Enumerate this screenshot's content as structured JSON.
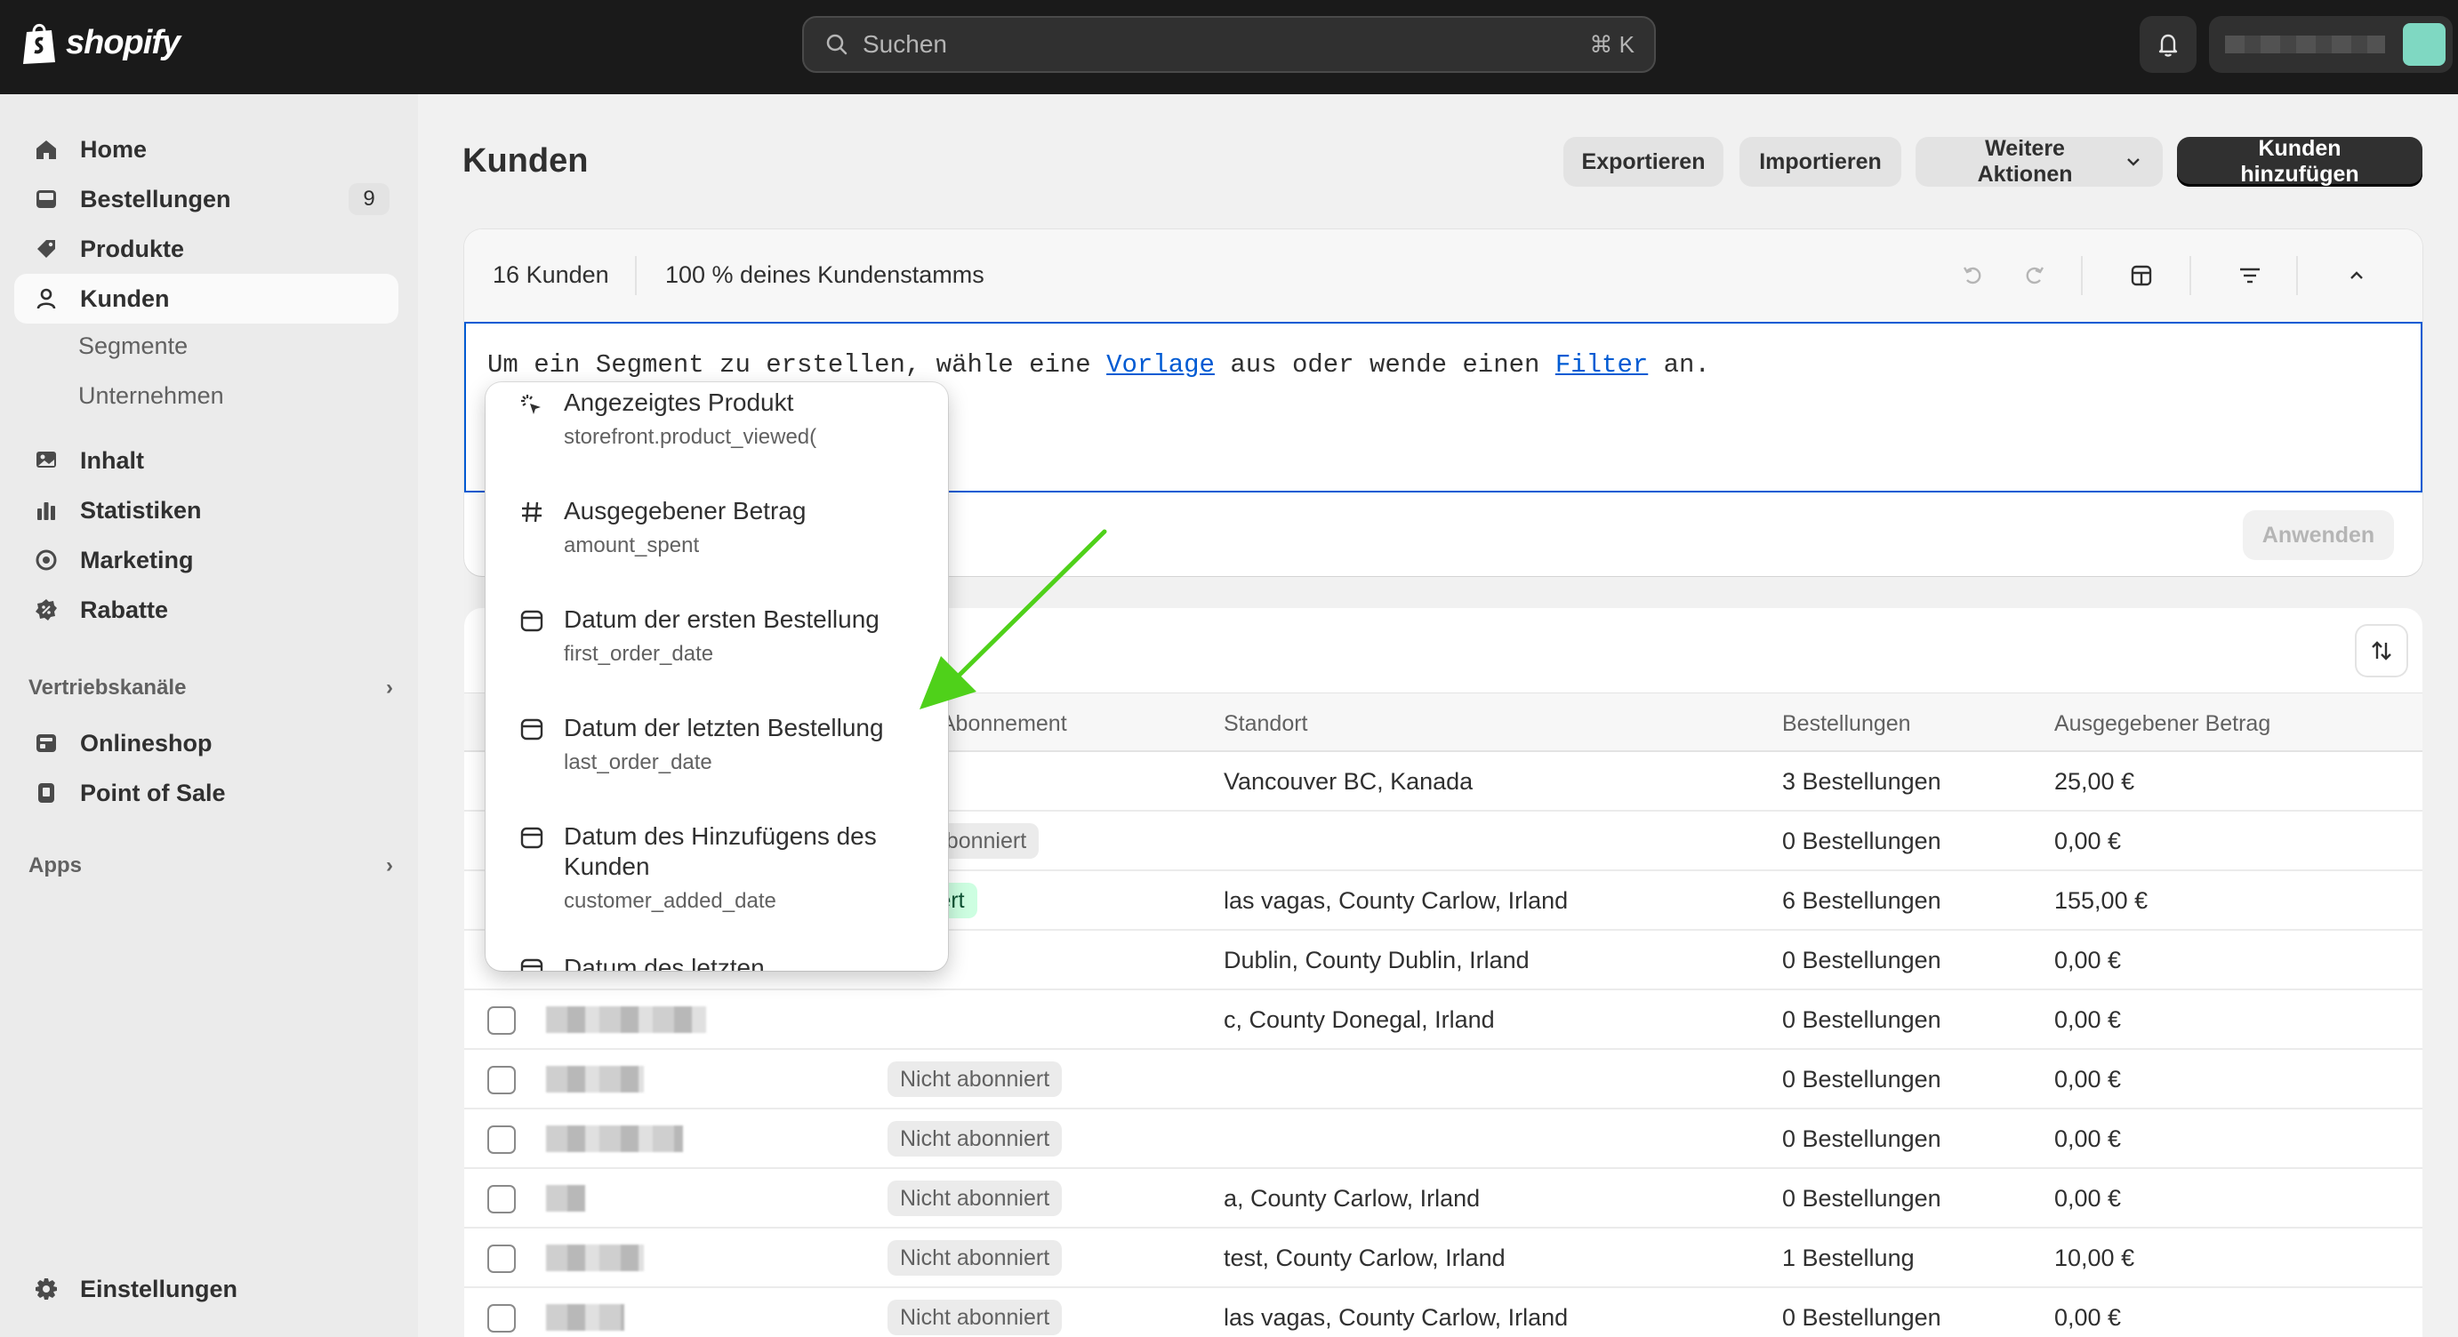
{
  "topbar": {
    "logo_text": "shopify",
    "search_placeholder": "Suchen",
    "search_shortcut": "⌘ K"
  },
  "sidebar": {
    "items": [
      {
        "label": "Home",
        "icon": "home-icon"
      },
      {
        "label": "Bestellungen",
        "icon": "inbox-icon",
        "badge": "9"
      },
      {
        "label": "Produkte",
        "icon": "tag-icon"
      },
      {
        "label": "Kunden",
        "icon": "person-icon",
        "active": true
      }
    ],
    "subitems": [
      "Segmente",
      "Unternehmen"
    ],
    "items2": [
      {
        "label": "Inhalt",
        "icon": "image-icon"
      },
      {
        "label": "Statistiken",
        "icon": "bar-chart-icon"
      },
      {
        "label": "Marketing",
        "icon": "target-icon"
      },
      {
        "label": "Rabatte",
        "icon": "discount-icon"
      }
    ],
    "sales_channels_heading": "Vertriebskanäle",
    "channels": [
      {
        "label": "Onlineshop",
        "icon": "store-icon"
      },
      {
        "label": "Point of Sale",
        "icon": "pos-icon"
      }
    ],
    "apps_heading": "Apps",
    "settings_label": "Einstellungen"
  },
  "page": {
    "title": "Kunden",
    "actions": {
      "export": "Exportieren",
      "import": "Importieren",
      "more": "Weitere Aktionen",
      "add": "Kunden hinzufügen"
    }
  },
  "segment": {
    "count_number": "16",
    "count_label": "Kunden",
    "percent_text": "100 % deines Kundenstamms",
    "editor": {
      "prefix": "Um ein Segment zu erstellen, wähle eine ",
      "link1": "Vorlage",
      "middle": " aus oder wende einen ",
      "link2": "Filter",
      "suffix": " an."
    },
    "apply_label": "Anwenden"
  },
  "dropdown": {
    "items": [
      {
        "title": "Angezeigtes Produkt",
        "sub": "storefront.product_viewed(",
        "icon": "cursor-click-icon"
      },
      {
        "title": "Ausgegebener Betrag",
        "sub": "amount_spent",
        "icon": "hash-icon"
      },
      {
        "title": "Datum der ersten Bestellung",
        "sub": "first_order_date",
        "icon": "calendar-icon"
      },
      {
        "title": "Datum der letzten Bestellung",
        "sub": "last_order_date",
        "icon": "calendar-icon"
      },
      {
        "title": "Datum des Hinzufügens des Kunden",
        "sub": "customer_added_date",
        "icon": "calendar-icon"
      },
      {
        "title": "Datum des letzten",
        "sub": "",
        "icon": "calendar-icon"
      }
    ]
  },
  "table": {
    "headers": {
      "subscription": "l-Abonnement",
      "location": "Standort",
      "orders": "Bestellungen",
      "spent": "Ausgegebener Betrag"
    },
    "rows": [
      {
        "sub": "",
        "loc": "Vancouver BC, Kanada",
        "orders": "3 Bestellungen",
        "spent": "25,00 €"
      },
      {
        "sub": "t abonniert",
        "loc": "",
        "orders": "0 Bestellungen",
        "spent": "0,00 €"
      },
      {
        "sub": "niert",
        "loc": "las vagas, County Carlow, Irland",
        "orders": "6 Bestellungen",
        "spent": "155,00 €"
      },
      {
        "sub": "",
        "loc": "Dublin, County Dublin, Irland",
        "orders": "0 Bestellungen",
        "spent": "0,00 €"
      },
      {
        "sub": "",
        "loc": "c, County Donegal, Irland",
        "orders": "0 Bestellungen",
        "spent": "0,00 €"
      },
      {
        "sub": "Nicht abonniert",
        "loc": "",
        "orders": "0 Bestellungen",
        "spent": "0,00 €"
      },
      {
        "sub": "Nicht abonniert",
        "loc": "",
        "orders": "0 Bestellungen",
        "spent": "0,00 €"
      },
      {
        "sub": "Nicht abonniert",
        "loc": "a, County Carlow, Irland",
        "orders": "0 Bestellungen",
        "spent": "0,00 €"
      },
      {
        "sub": "Nicht abonniert",
        "loc": "test, County Carlow, Irland",
        "orders": "1 Bestellung",
        "spent": "10,00 €"
      },
      {
        "sub": "Nicht abonniert",
        "loc": "las vagas, County Carlow, Irland",
        "orders": "0 Bestellungen",
        "spent": "0,00 €"
      }
    ]
  },
  "colors": {
    "topbar": "#1a1a1a",
    "primary_button": "#303030",
    "link": "#005bd3",
    "subscribed_badge": "#cdfee1",
    "annotation_arrow": "#4fd11a"
  }
}
